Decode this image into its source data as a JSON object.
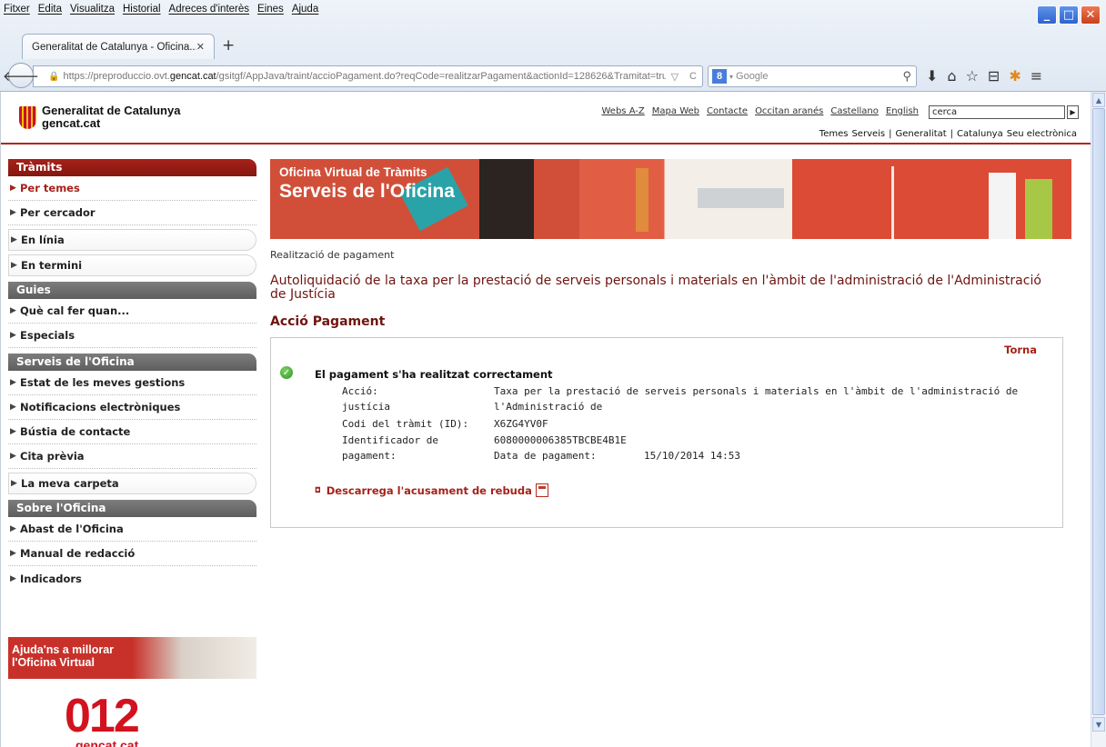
{
  "browser": {
    "menu": [
      "Fitxer",
      "Edita",
      "Visualitza",
      "Historial",
      "Adreces d'interès",
      "Eines",
      "Ajuda"
    ],
    "tab_title": "Generalitat de Catalunya - Oficina...",
    "tab_close": "✕",
    "new_tab": "+",
    "url_prefix": "https://preproduccio.ovt.",
    "url_host": "gencat.cat",
    "url_tail": "/gsitgf/AppJava/traint/accioPagament.do?reqCode=realitzarPagament&actionId=128626&Tramitat=tru",
    "search_placeholder": "Google",
    "search_engine_icon": "google-g-icon"
  },
  "header": {
    "logo_line1": "Generalitat de Catalunya",
    "logo_line2": "gencat.cat",
    "top_links": [
      "Webs A-Z",
      "Mapa Web",
      "Contacte",
      "Occitan aranés",
      "Castellano",
      "English"
    ],
    "search_value": "cerca",
    "sec_links": [
      "Temes",
      "Serveis",
      "|",
      "Generalitat",
      "|",
      "Catalunya",
      "Seu electrònica"
    ]
  },
  "sidebar": {
    "tramits_head": "Tràmits",
    "tramits": [
      "Per temes",
      "Per cercador"
    ],
    "tramits_pills": [
      "En línia",
      "En termini"
    ],
    "guies_head": "Guies",
    "guies": [
      "Què cal fer quan...",
      "Especials"
    ],
    "serveis_head": "Serveis de l'Oficina",
    "serveis": [
      "Estat de les meves gestions",
      "Notificacions electròniques",
      "Bústia de contacte",
      "Cita prèvia"
    ],
    "serveis_pill": "La meva carpeta",
    "sobre_head": "Sobre l'Oficina",
    "sobre": [
      "Abast de l'Oficina",
      "Manual de redacció",
      "Indicadors"
    ],
    "help_line1": "Ajuda'ns a millorar",
    "help_line2": "l'Oficina Virtual",
    "logo_012": "012",
    "logo_012_sub": "gencat.cat"
  },
  "banner": {
    "line1": "Oficina Virtual de Tràmits",
    "line2": "Serveis de l'Oficina"
  },
  "main": {
    "breadcrumb": "Realització de pagament",
    "title": "Autoliquidació de la taxa per la prestació de serveis personals i materials en l'àmbit de l'administració de l'Administració de Justícia",
    "section": "Acció Pagament",
    "back": "Torna",
    "ok_message": "El pagament s'ha realitzat correctament",
    "label_accio": "Acció:",
    "value_accio_1": "Taxa per la prestació de serveis personals i materials en l'àmbit de l'administració de l'Administració de",
    "value_accio_2": "justícia",
    "label_codi": "Codi del tràmit (ID):",
    "value_codi": "X6ZG4YV0F",
    "label_ident_1": "Identificador de",
    "label_ident_2": "pagament:",
    "value_ident": "6080000006385TBCBE4B1E",
    "label_data": "Data de pagament:",
    "value_data": "15/10/2014 14:53",
    "download": "Descarrega l'acusament de rebuda"
  },
  "colors": {
    "brand_red": "#a5221a",
    "title_red": "#6f1410",
    "banner_orange": "#d35940"
  }
}
